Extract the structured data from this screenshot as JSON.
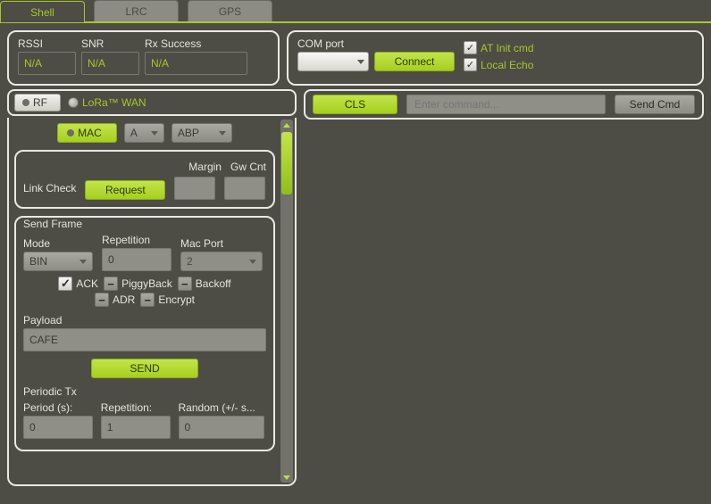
{
  "tabs": {
    "shell": "Shell",
    "lrc": "LRC",
    "gps": "GPS"
  },
  "stats": {
    "rssi_label": "RSSI",
    "rssi_value": "N/A",
    "snr_label": "SNR",
    "snr_value": "N/A",
    "rxsucc_label": "Rx Success",
    "rxsucc_value": "N/A"
  },
  "com": {
    "label": "COM port",
    "connect": "Connect",
    "atinit": "AT Init cmd",
    "localecho": "Local Echo"
  },
  "rf": {
    "rf": "RF",
    "lorawan": "LoRa™ WAN"
  },
  "mac": {
    "mac": "MAC",
    "class_sel": "A",
    "join_sel": "ABP"
  },
  "linkcheck": {
    "label": "Link Check",
    "request": "Request",
    "margin": "Margin",
    "gwcnt": "Gw Cnt"
  },
  "sendframe": {
    "title": "Send Frame",
    "mode_label": "Mode",
    "mode_value": "BIN",
    "rep_label": "Repetition",
    "rep_value": "0",
    "port_label": "Mac Port",
    "port_value": "2",
    "ack": "ACK",
    "piggy": "PiggyBack",
    "backoff": "Backoff",
    "adr": "ADR",
    "encrypt": "Encrypt",
    "payload_label": "Payload",
    "payload_value": "CAFE",
    "send": "SEND",
    "periodic_title": "Periodic Tx",
    "period_label": "Period (s):",
    "period_value": "0",
    "rep2_label": "Repetition:",
    "rep2_value": "1",
    "rand_label": "Random (+/- s...",
    "rand_value": "0"
  },
  "cmdbar": {
    "cls": "CLS",
    "placeholder": "Enter command...",
    "send": "Send Cmd"
  }
}
